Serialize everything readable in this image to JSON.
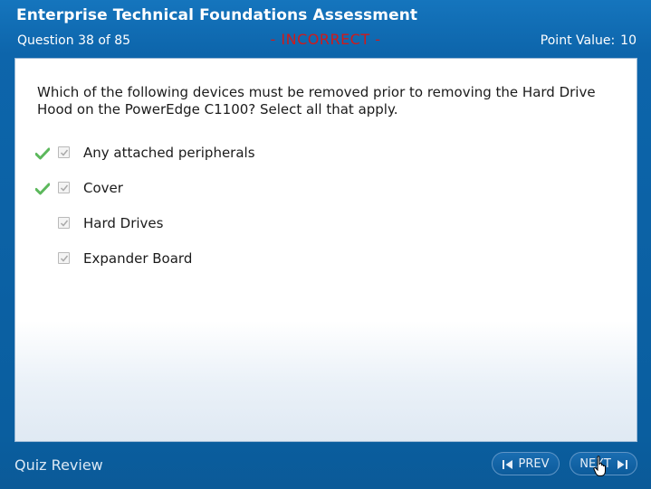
{
  "header": {
    "title": "Enterprise Technical Foundations Assessment",
    "question_counter": "Question 38 of 85",
    "status": "- INCORRECT -",
    "point_value_label": "Point Value:",
    "point_value": "10"
  },
  "question": {
    "text": "Which of the following devices must be removed prior to removing the Hard Drive Hood on the PowerEdge C1100? Select all that apply.",
    "options": [
      {
        "label": "Any attached peripherals",
        "selected": true,
        "correct_marker": true
      },
      {
        "label": "Cover",
        "selected": true,
        "correct_marker": true
      },
      {
        "label": "Hard Drives",
        "selected": true,
        "correct_marker": false
      },
      {
        "label": "Expander Board",
        "selected": true,
        "correct_marker": false
      }
    ]
  },
  "footer": {
    "mode_label": "Quiz Review",
    "prev_label": "PREV",
    "next_label": "NEXT"
  },
  "colors": {
    "background": "#0d65ab",
    "status_incorrect": "#d11a1a",
    "correct_check": "#5cb85c"
  }
}
